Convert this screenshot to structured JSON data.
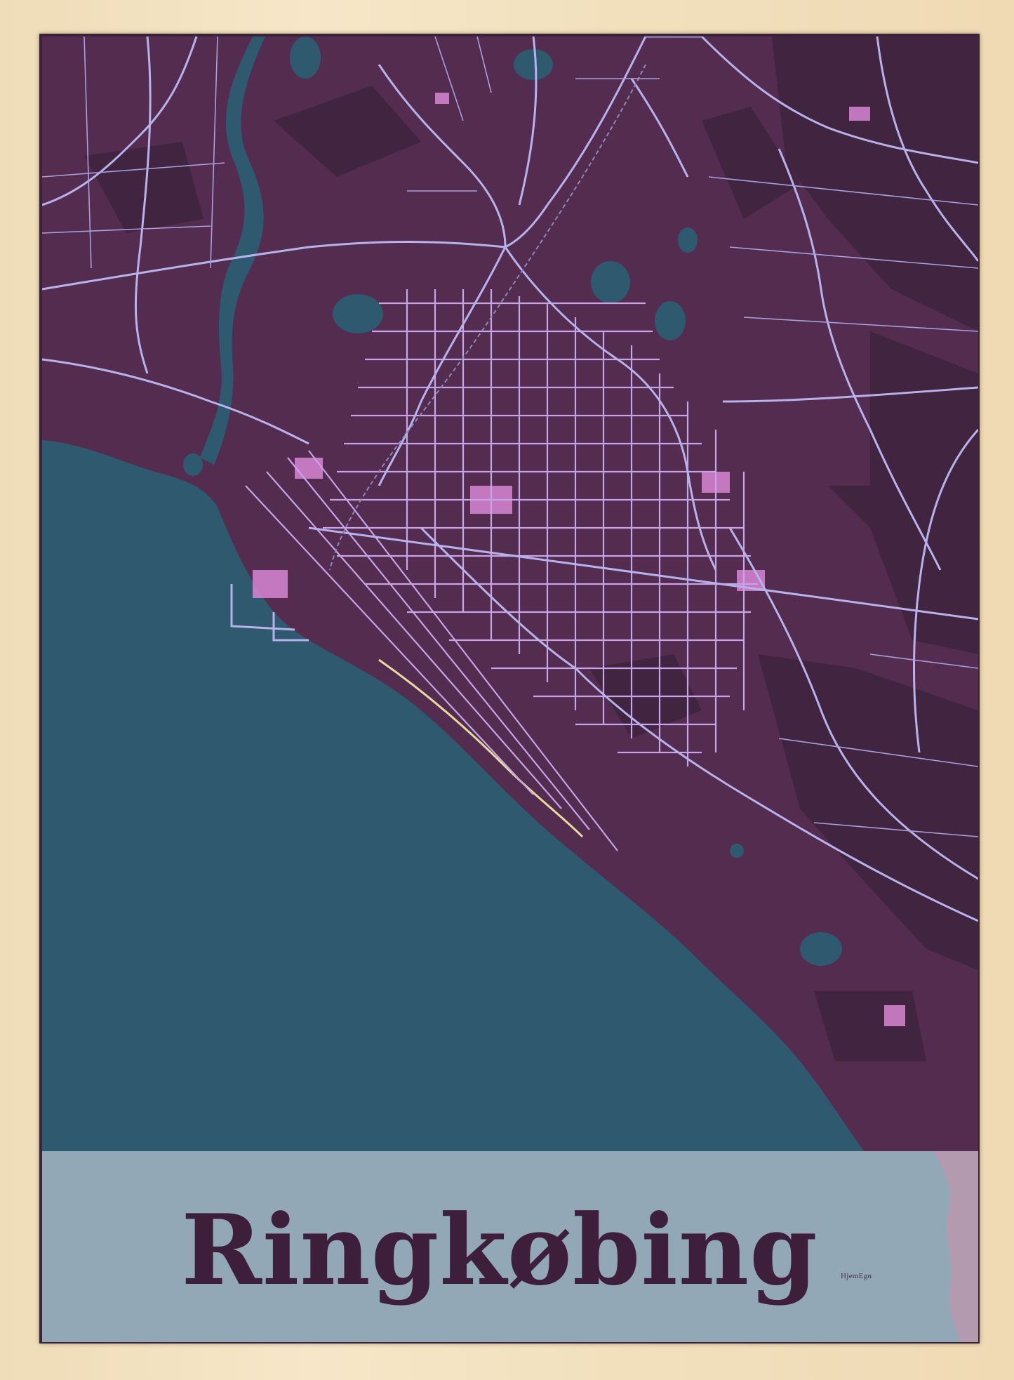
{
  "poster": {
    "city": "Ringkøbing",
    "brand": "HjemEgn"
  },
  "colors": {
    "frame": "#f4e4c3",
    "land": "#532c4f",
    "land_dark": "#41243f",
    "water": "#2f596f",
    "roads": "#b8b2ec",
    "buildings": "#d786d2",
    "label_band": "#93a8b6",
    "title_text": "#3d1f3b"
  },
  "map": {
    "features": [
      "lake-water",
      "river",
      "town-road-network",
      "railway",
      "coastline"
    ]
  }
}
